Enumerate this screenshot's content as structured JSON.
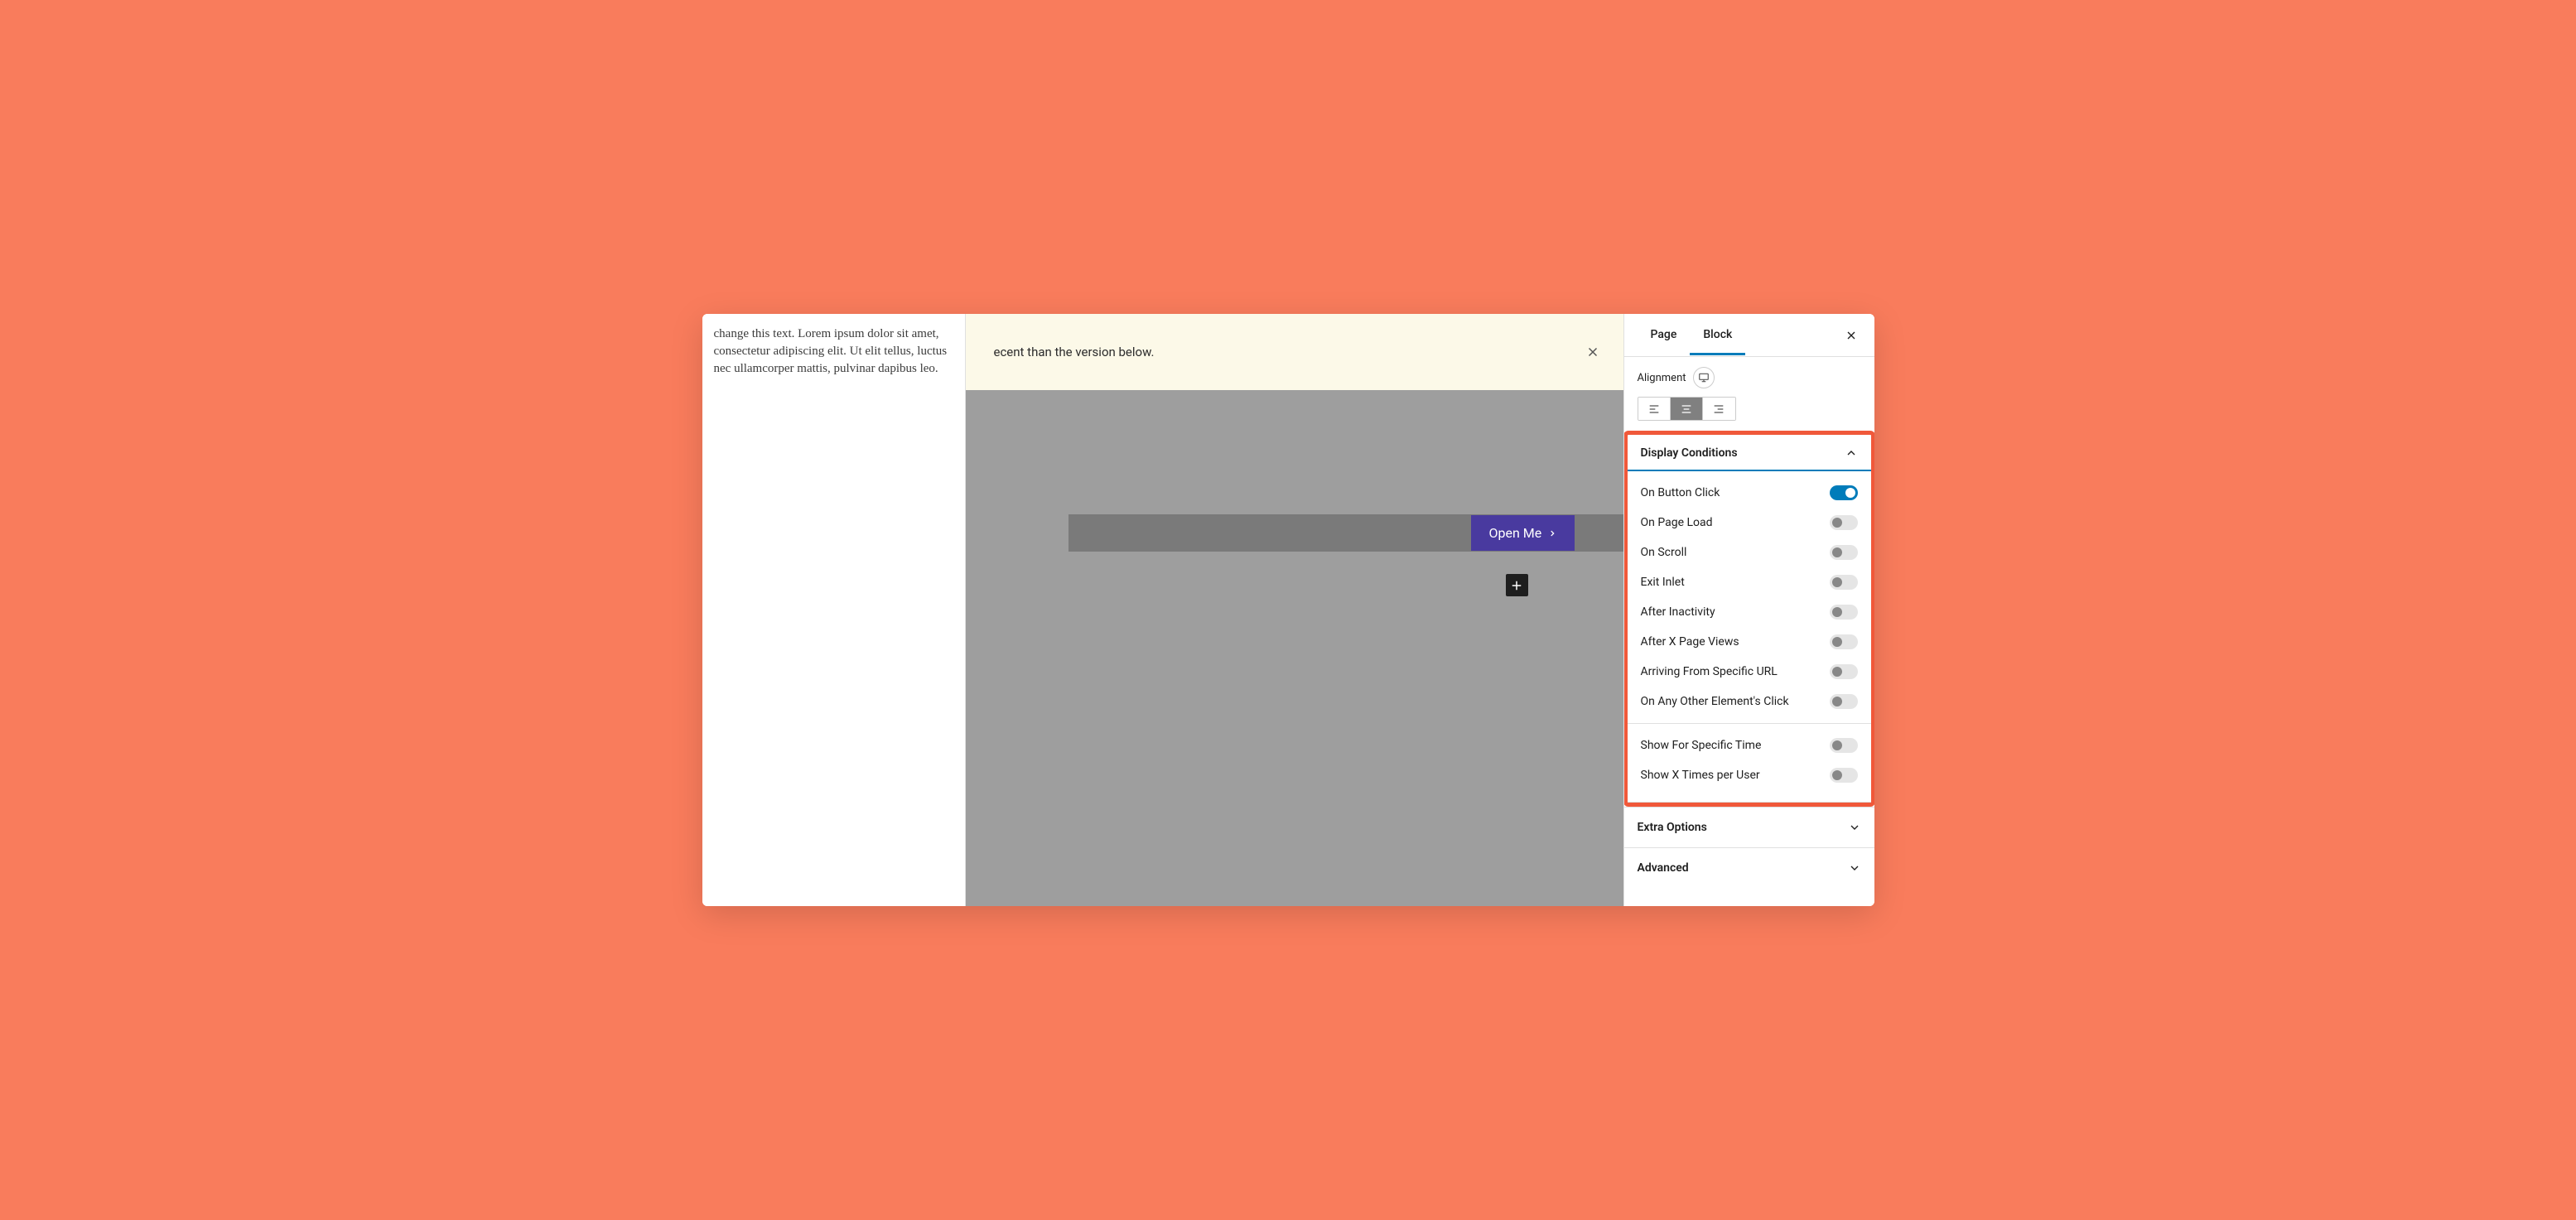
{
  "left": {
    "lorem": "change this text. Lorem ipsum dolor sit amet, consectetur adipiscing elit. Ut elit tellus, luctus nec ullamcorper mattis, pulvinar dapibus leo."
  },
  "notice": {
    "text": "ecent than the version below."
  },
  "canvas": {
    "open_button": "Open Me"
  },
  "sidebar": {
    "tabs": {
      "page": "Page",
      "block": "Block"
    },
    "alignment": {
      "label": "Alignment"
    },
    "display_conditions": {
      "title": "Display Conditions",
      "items": [
        {
          "label": "On Button Click",
          "on": true
        },
        {
          "label": "On Page Load",
          "on": false
        },
        {
          "label": "On Scroll",
          "on": false
        },
        {
          "label": "Exit Inlet",
          "on": false
        },
        {
          "label": "After Inactivity",
          "on": false
        },
        {
          "label": "After X Page Views",
          "on": false
        },
        {
          "label": "Arriving From Specific URL",
          "on": false
        },
        {
          "label": "On Any Other Element's Click",
          "on": false
        }
      ],
      "items2": [
        {
          "label": "Show For Specific Time",
          "on": false
        },
        {
          "label": "Show X Times per User",
          "on": false
        }
      ]
    },
    "extra_options": {
      "title": "Extra Options"
    },
    "advanced": {
      "title": "Advanced"
    }
  }
}
